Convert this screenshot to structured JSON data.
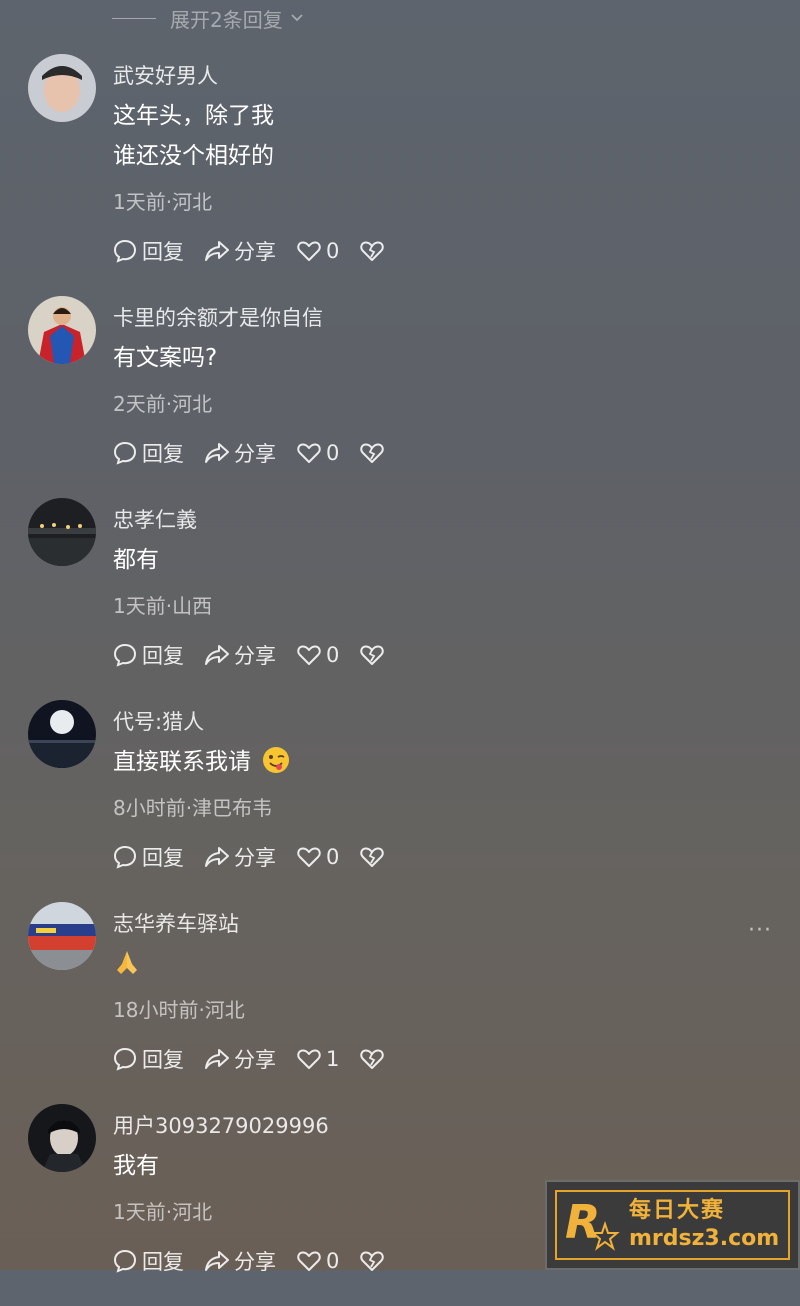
{
  "expand": {
    "label": "展开2条回复"
  },
  "actions": {
    "reply_label": "回复",
    "share_label": "分享"
  },
  "comments": [
    {
      "username": "武安好男人",
      "lines": [
        "这年头，除了我",
        "谁还没个相好的"
      ],
      "meta": "1天前·河北",
      "likes": "0"
    },
    {
      "username": "卡里的余额才是你自信",
      "lines": [
        "有文案吗?"
      ],
      "meta": "2天前·河北",
      "likes": "0"
    },
    {
      "username": "忠孝仁義",
      "lines": [
        "都有"
      ],
      "meta": "1天前·山西",
      "likes": "0"
    },
    {
      "username": "代号:猎人",
      "lines": [
        "直接联系我请"
      ],
      "meta": "8小时前·津巴布韦",
      "likes": "0"
    },
    {
      "username": "志华养车驿站",
      "lines": [
        ""
      ],
      "meta": "18小时前·河北",
      "likes": "1"
    },
    {
      "username": "用户3093279029996",
      "lines": [
        "我有"
      ],
      "meta": "1天前·河北",
      "likes": "0"
    }
  ],
  "watermark": {
    "name": "每日大赛",
    "url": "mrdsz3.com",
    "badge": "每日大赛"
  },
  "icons": {
    "reply": "reply-bubble-icon",
    "share": "share-arrow-icon",
    "like": "heart-icon",
    "dislike": "broken-heart-icon",
    "more": "more-dots-icon",
    "expand": "chevron-down-icon"
  }
}
